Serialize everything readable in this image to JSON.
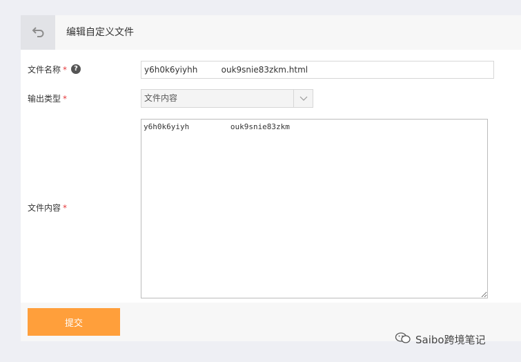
{
  "header": {
    "title": "编辑自定义文件"
  },
  "form": {
    "filename": {
      "label": "文件名称",
      "required": "*",
      "help_icon": "?",
      "value": "y6h0k6yiyhh         ouk9snie83zkm.html"
    },
    "output_type": {
      "label": "输出类型",
      "required": "*",
      "selected": "文件内容"
    },
    "content": {
      "label": "文件内容",
      "required": "*",
      "value": "y6h0k6yiyh         ouk9snie83zkm"
    }
  },
  "footer": {
    "submit_label": "提交"
  },
  "watermark": {
    "text": "Saibo跨境笔记"
  }
}
